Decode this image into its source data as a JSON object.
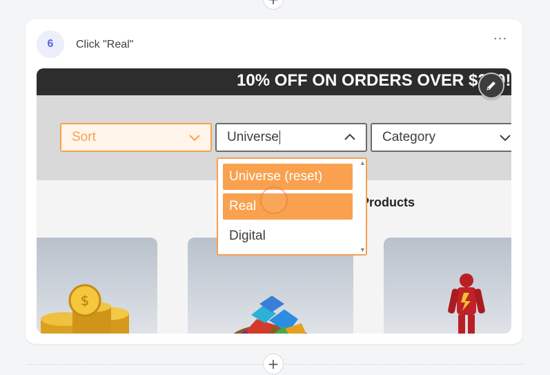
{
  "step": {
    "number": "6",
    "title": "Click \"Real\"",
    "more_label": "···"
  },
  "controls": {
    "add_label": "+"
  },
  "screenshot": {
    "promo_text": "10% OFF ON ORDERS OVER $200!",
    "filters": {
      "sort_label": "Sort",
      "universe_value": "Universe",
      "category_label": "Category"
    },
    "universe_menu": {
      "options": [
        "Universe (reset)",
        "Real",
        "Digital"
      ]
    },
    "products_title": "Products",
    "products": [
      "gold-coins-image",
      "gems-image",
      "flash-figure-image"
    ]
  },
  "colors": {
    "accent": "#f7a04d",
    "badge_bg": "#eceefc",
    "badge_text": "#5a64d8",
    "promo_bg": "#2d2d2d"
  }
}
